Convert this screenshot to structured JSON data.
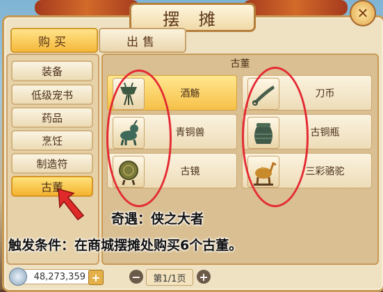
{
  "window": {
    "title": "摆 摊"
  },
  "tabs": [
    {
      "label": "购买",
      "selected": true
    },
    {
      "label": "出售",
      "selected": false
    }
  ],
  "categories": [
    {
      "label": "装备"
    },
    {
      "label": "低级宠书"
    },
    {
      "label": "药品"
    },
    {
      "label": "烹饪"
    },
    {
      "label": "制造符"
    },
    {
      "label": "古董",
      "selected": true
    }
  ],
  "section": {
    "title": "古董"
  },
  "items": [
    {
      "name": "酒觞",
      "icon": "bronze-jue-icon",
      "selected": true
    },
    {
      "name": "刀币",
      "icon": "knife-coin-icon"
    },
    {
      "name": "青铜兽",
      "icon": "bronze-beast-icon"
    },
    {
      "name": "古铜瓶",
      "icon": "bronze-vase-icon"
    },
    {
      "name": "古镜",
      "icon": "ancient-mirror-icon"
    },
    {
      "name": "三彩骆驼",
      "icon": "tricolor-camel-icon"
    }
  ],
  "annotation": {
    "line1": "奇遇：侠之大者",
    "line2": "触发条件：在商城摆摊处购买6个古董。"
  },
  "footer": {
    "money": "48,273,359",
    "plus": "+",
    "minus": "−",
    "page": "第1/1页",
    "page_next": "+"
  },
  "colors": {
    "highlight": "#f5b83a",
    "annotation_red": "#e42a32"
  }
}
